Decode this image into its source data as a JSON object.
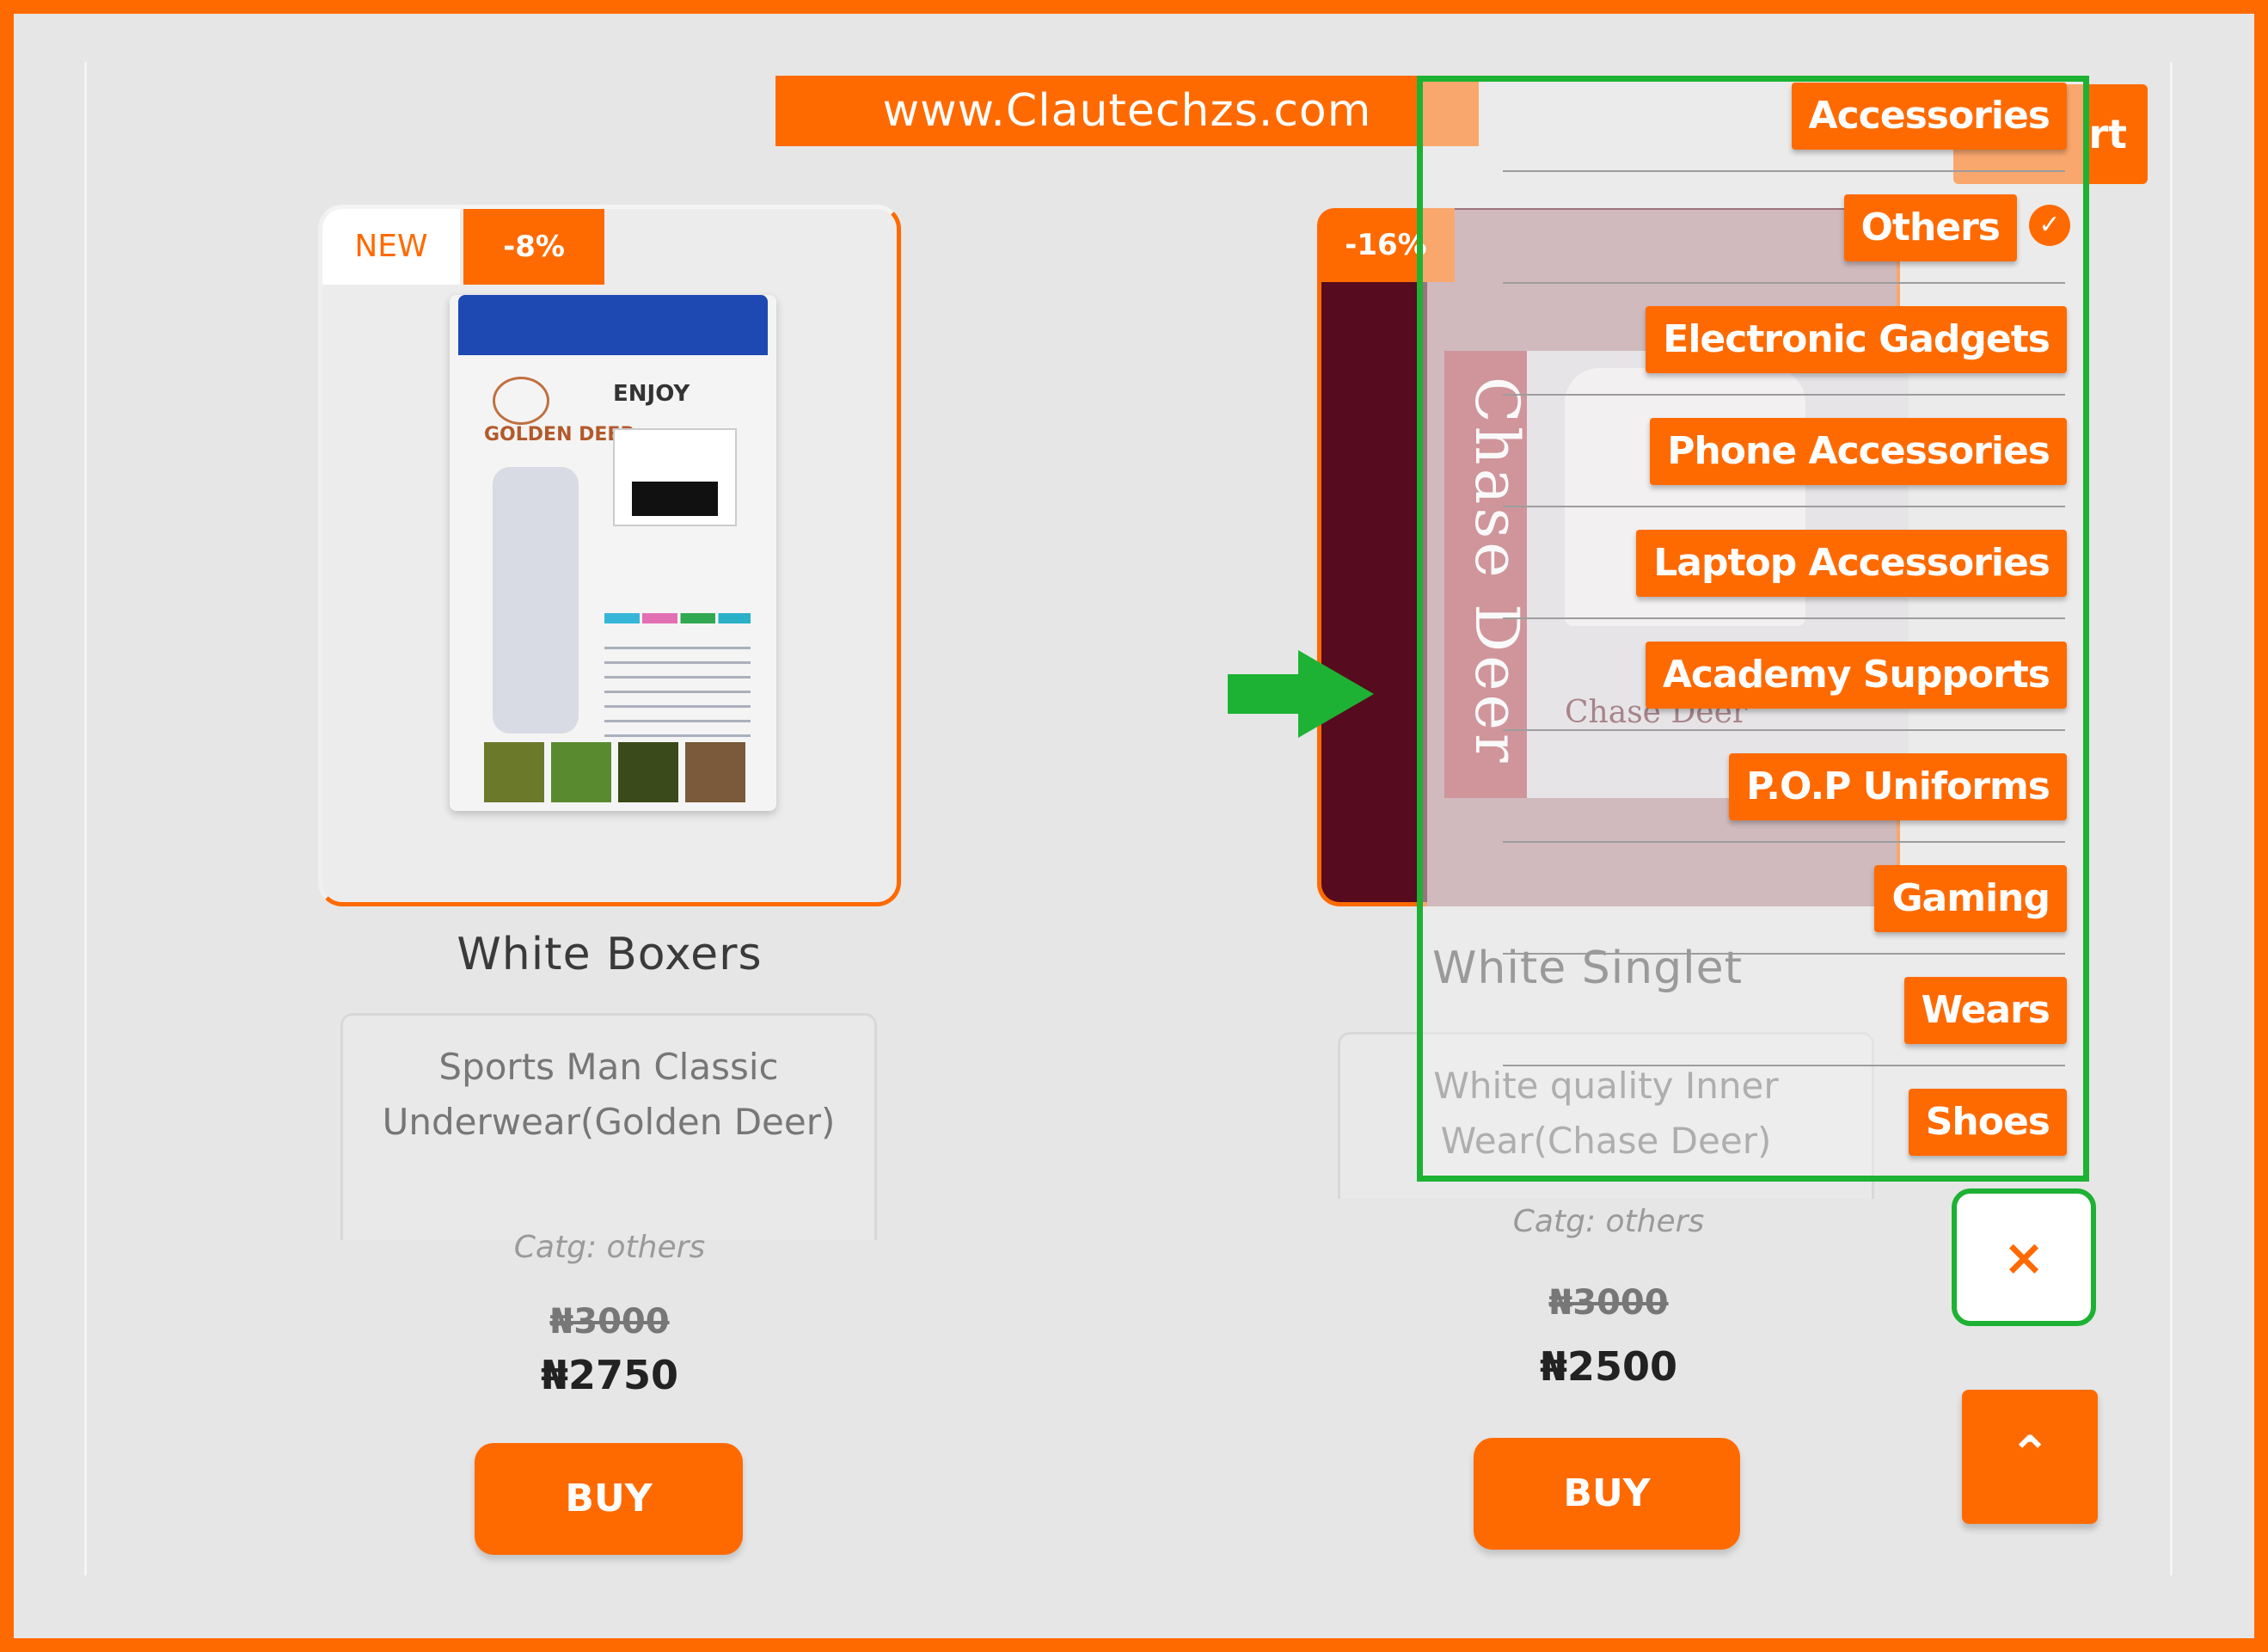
{
  "banner": {
    "text": "www.Clautechzs.com"
  },
  "products": [
    {
      "badge_new": "NEW",
      "badge_discount": "-8%",
      "title": "White Boxers",
      "description": "Sports Man Classic Underwear(Golden Deer)",
      "category": "Catg: others",
      "old_price": "₦3000",
      "new_price": "₦2750",
      "buy_label": "BUY"
    },
    {
      "badge_discount": "-16%",
      "title": "White Singlet",
      "description": "White quality Inner Wear(Chase Deer)",
      "category": "Catg: others",
      "old_price": "₦3000",
      "new_price": "₦2500",
      "buy_label": "BUY"
    }
  ],
  "category_menu": {
    "items": [
      "Accessories",
      "Others",
      "Electronic Gadgets",
      "Phone Accessories",
      "Laptop Accessories",
      "Academy Supports",
      "P.O.P Uniforms",
      "Gaming",
      "Wears",
      "Shoes"
    ],
    "selected": "Others",
    "selected_icon": "check-circle-icon"
  },
  "cart_button": {
    "label_visible": "rt"
  },
  "close_button": {
    "label": "×",
    "icon": "close-icon"
  },
  "scroll_top_button": {
    "label": "⌃",
    "icon": "chevron-up-icon"
  },
  "annotations": {
    "arrow_icon": "arrow-right-icon",
    "highlight_color": "#1db233"
  },
  "colors": {
    "accent": "#ff6a00",
    "background": "#e6e6e6",
    "dark_card": "#570b1e"
  }
}
